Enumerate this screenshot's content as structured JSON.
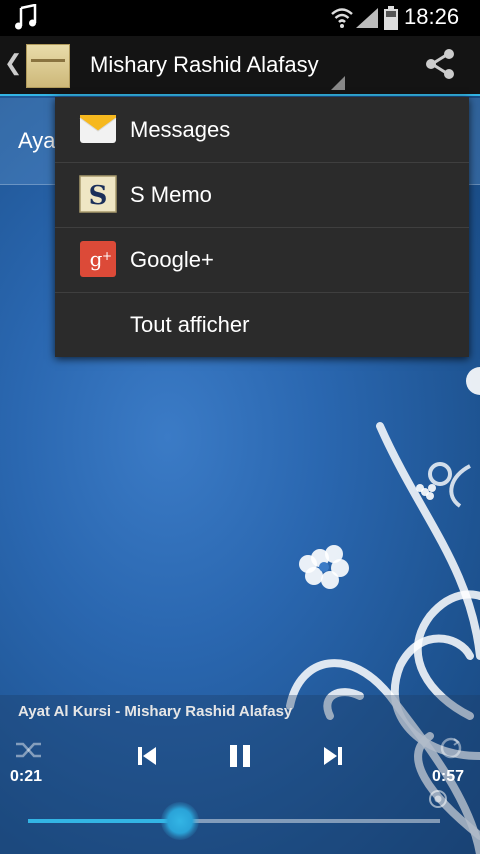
{
  "status_bar": {
    "time": "18:26",
    "notification_icon": "music-note-icon"
  },
  "action_bar": {
    "title": "Mishary Rashid Alafasy",
    "share_icon": "share-icon",
    "back_icon": "chevron-left-icon"
  },
  "list": {
    "first_item_visible": "Aya"
  },
  "share_menu": {
    "items": [
      {
        "label": "Messages",
        "icon": "messages-envelope-icon"
      },
      {
        "label": "S Memo",
        "icon": "s-memo-icon"
      },
      {
        "label": "Google+",
        "icon": "google-plus-icon"
      },
      {
        "label": "Tout afficher",
        "icon": ""
      }
    ]
  },
  "player": {
    "track_title": "Ayat Al Kursi - Mishary Rashid Alafasy",
    "elapsed": "0:21",
    "total": "0:57",
    "progress_fraction": 0.37,
    "accent_color": "#33b5e5"
  }
}
